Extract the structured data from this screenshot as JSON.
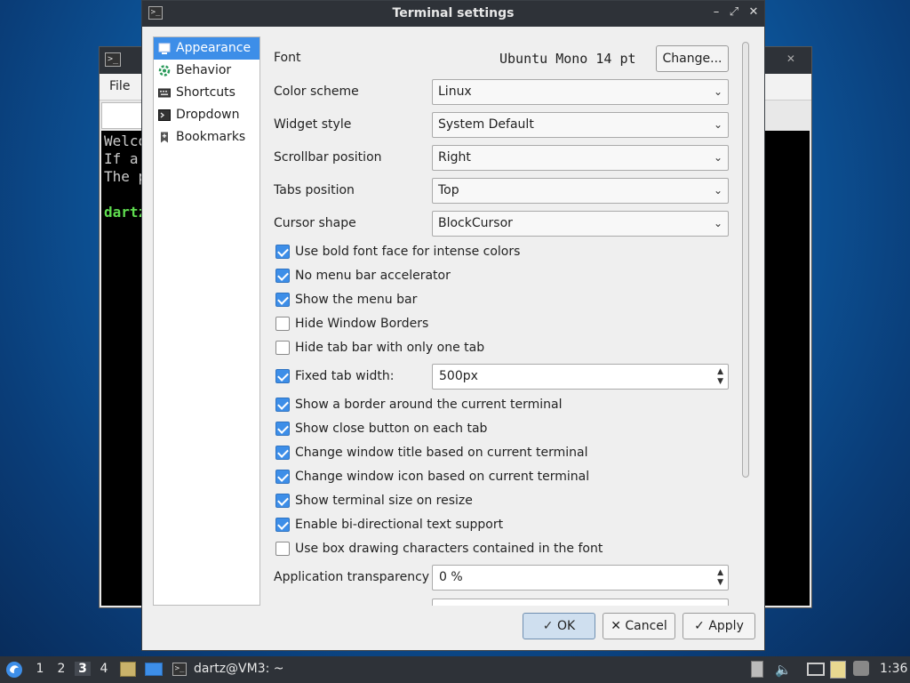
{
  "bg_terminal": {
    "menu_file": "File",
    "lines": [
      "Welco",
      "If a",
      "The p",
      "",
      "dartz"
    ]
  },
  "dialog": {
    "title": "Terminal settings",
    "controls": [
      "–",
      "⤢",
      "✕"
    ]
  },
  "sidebar": {
    "items": [
      {
        "label": "Appearance",
        "icon": "appearance-icon",
        "active": true
      },
      {
        "label": "Behavior",
        "icon": "behavior-icon",
        "active": false
      },
      {
        "label": "Shortcuts",
        "icon": "keyboard-icon",
        "active": false
      },
      {
        "label": "Dropdown",
        "icon": "terminal-icon",
        "active": false
      },
      {
        "label": "Bookmarks",
        "icon": "bookmark-icon",
        "active": false
      }
    ]
  },
  "settings": {
    "font_label": "Font",
    "font_value": "Ubuntu Mono 14 pt",
    "font_button": "Change...",
    "color_scheme": {
      "label": "Color scheme",
      "value": "Linux"
    },
    "widget_style": {
      "label": "Widget style",
      "value": "System Default"
    },
    "scrollbar_position": {
      "label": "Scrollbar position",
      "value": "Right"
    },
    "tabs_position": {
      "label": "Tabs position",
      "value": "Top"
    },
    "cursor_shape": {
      "label": "Cursor shape",
      "value": "BlockCursor"
    },
    "checks_a": [
      {
        "label": "Use bold font face for intense colors",
        "checked": true
      },
      {
        "label": "No menu bar accelerator",
        "checked": true
      },
      {
        "label": "Show the menu bar",
        "checked": true
      },
      {
        "label": "Hide Window Borders",
        "checked": false
      },
      {
        "label": "Hide tab bar with only one tab",
        "checked": false
      }
    ],
    "fixed_tab": {
      "label": "Fixed tab width:",
      "checked": true,
      "value": "500px"
    },
    "checks_b": [
      {
        "label": "Show a border around the current terminal",
        "checked": true
      },
      {
        "label": "Show close button on each tab",
        "checked": true
      },
      {
        "label": "Change window title based on current terminal",
        "checked": true
      },
      {
        "label": "Change window icon based on current terminal",
        "checked": true
      },
      {
        "label": "Show terminal size on resize",
        "checked": true
      },
      {
        "label": "Enable bi-directional text support",
        "checked": true
      },
      {
        "label": "Use box drawing characters contained in the font",
        "checked": false
      }
    ],
    "app_transparency": {
      "label": "Application transparency",
      "value": "0 %"
    }
  },
  "buttons": {
    "ok": "OK",
    "cancel": "Cancel",
    "apply": "Apply"
  },
  "taskbar": {
    "workspaces": [
      "1",
      "2",
      "3",
      "4"
    ],
    "current_workspace": "3",
    "task_label": "dartz@VM3: ~",
    "clock": "1:36"
  },
  "colors": {
    "accent": "#3d8ee8",
    "titlebar": "#2e3238",
    "prompt_green": "#5fdc4f"
  }
}
